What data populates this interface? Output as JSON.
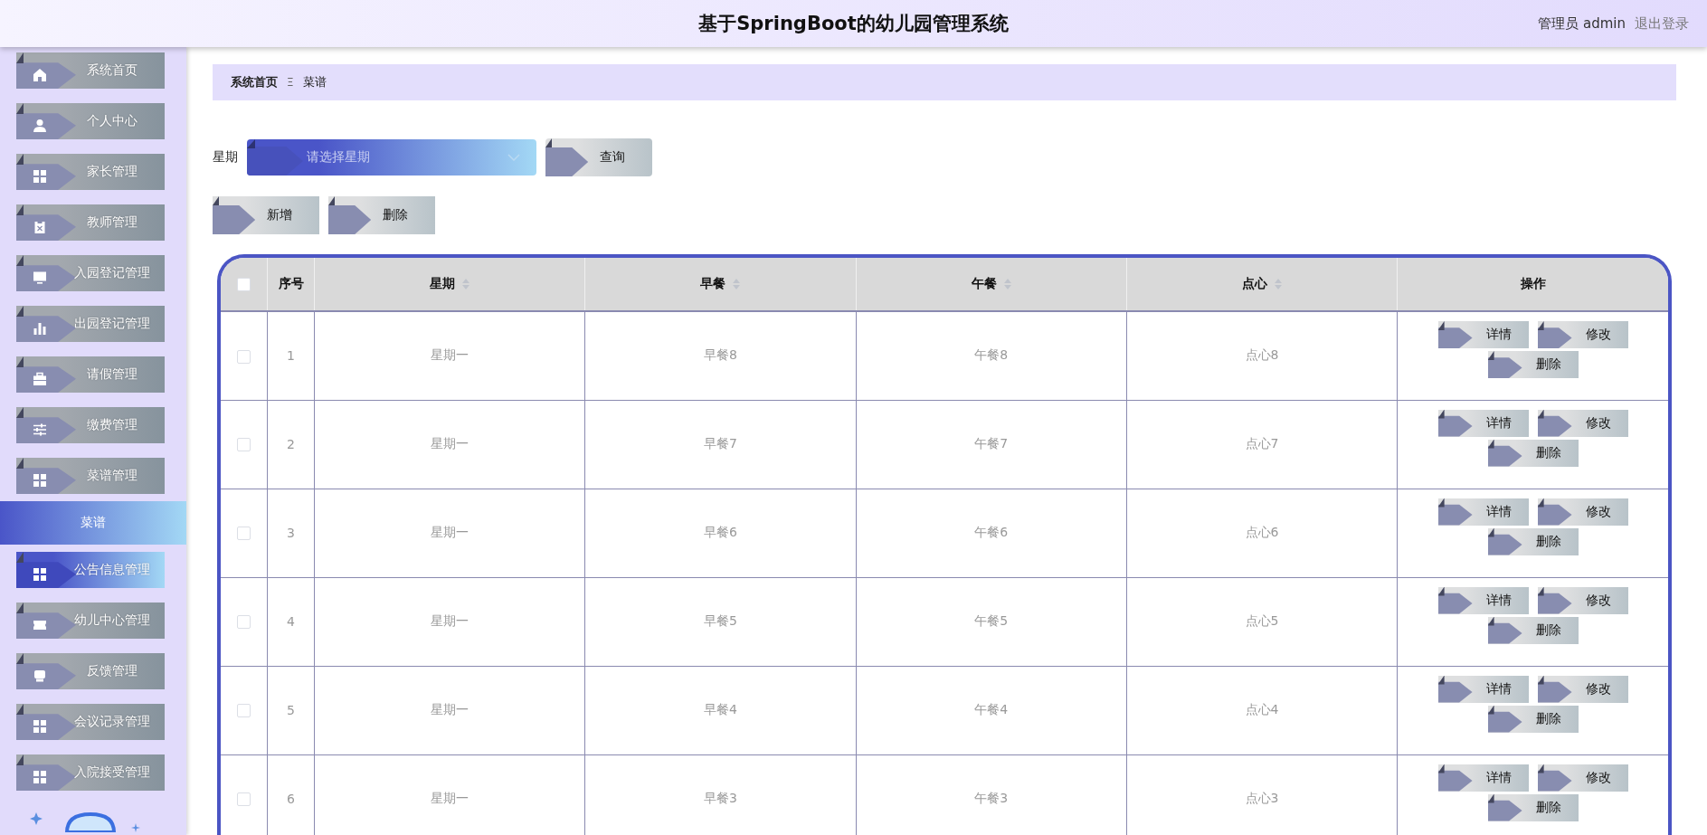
{
  "header": {
    "title": "基于SpringBoot的幼儿园管理系统",
    "user": "管理员 admin",
    "logout": "退出登录"
  },
  "sidebar": {
    "items": [
      {
        "label": "系统首页",
        "hovered": false
      },
      {
        "label": "个人中心",
        "hovered": false
      },
      {
        "label": "家长管理",
        "hovered": false
      },
      {
        "label": "教师管理",
        "hovered": false
      },
      {
        "label": "入园登记管理",
        "hovered": false
      },
      {
        "label": "出园登记管理",
        "hovered": false
      },
      {
        "label": "请假管理",
        "hovered": false
      },
      {
        "label": "缴费管理",
        "hovered": false
      },
      {
        "label": "菜谱管理",
        "hovered": false,
        "children": [
          {
            "label": "菜谱",
            "selected": true
          }
        ]
      },
      {
        "label": "公告信息管理",
        "hovered": true
      },
      {
        "label": "幼儿中心管理",
        "hovered": false
      },
      {
        "label": "反馈管理",
        "hovered": false
      },
      {
        "label": "会议记录管理",
        "hovered": false
      },
      {
        "label": "入院接受管理",
        "hovered": false
      }
    ]
  },
  "breadcrumb": {
    "items": [
      "系统首页",
      "菜谱"
    ],
    "separator": "Ξ"
  },
  "search": {
    "label": "星期",
    "placeholder": "请选择星期",
    "button": "查询"
  },
  "actions": [
    "新增",
    "删除"
  ],
  "table": {
    "all_checked": false,
    "columns": [
      {
        "label": "序号",
        "sortable": false
      },
      {
        "label": "星期",
        "sortable": true
      },
      {
        "label": "早餐",
        "sortable": true
      },
      {
        "label": "午餐",
        "sortable": true
      },
      {
        "label": "点心",
        "sortable": true
      },
      {
        "label": "操作",
        "sortable": false
      }
    ],
    "rows": [
      {
        "index": "1",
        "weekday": "星期一",
        "breakfast": "早餐8",
        "lunch": "午餐8",
        "snack": "点心8",
        "checked": false,
        "actions": [
          "详情",
          "修改",
          "删除"
        ]
      },
      {
        "index": "2",
        "weekday": "星期一",
        "breakfast": "早餐7",
        "lunch": "午餐7",
        "snack": "点心7",
        "checked": false,
        "actions": [
          "详情",
          "修改",
          "删除"
        ]
      },
      {
        "index": "3",
        "weekday": "星期一",
        "breakfast": "早餐6",
        "lunch": "午餐6",
        "snack": "点心6",
        "checked": false,
        "actions": [
          "详情",
          "修改",
          "删除"
        ]
      },
      {
        "index": "4",
        "weekday": "星期一",
        "breakfast": "早餐5",
        "lunch": "午餐5",
        "snack": "点心5",
        "checked": false,
        "actions": [
          "详情",
          "修改",
          "删除"
        ]
      },
      {
        "index": "5",
        "weekday": "星期一",
        "breakfast": "早餐4",
        "lunch": "午餐4",
        "snack": "点心4",
        "checked": false,
        "actions": [
          "详情",
          "修改",
          "删除"
        ]
      },
      {
        "index": "6",
        "weekday": "星期一",
        "breakfast": "早餐3",
        "lunch": "午餐3",
        "snack": "点心3",
        "checked": false,
        "actions": [
          "详情",
          "修改",
          "删除"
        ]
      }
    ]
  }
}
